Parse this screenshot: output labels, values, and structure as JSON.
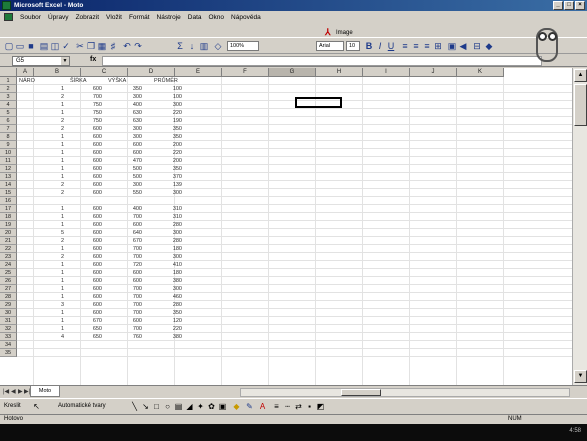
{
  "window": {
    "title": "Microsoft Excel - Moto"
  },
  "menu": [
    "Soubor",
    "Úpravy",
    "Zobrazit",
    "Vložit",
    "Formát",
    "Nástroje",
    "Data",
    "Okno",
    "Nápověda"
  ],
  "mail_button": {
    "label": "Image"
  },
  "toolbar": {
    "zoom": "100%",
    "font": "Arial",
    "font_size": "10"
  },
  "name_box": {
    "value": "G5"
  },
  "formula_bar": {
    "fx": "fx",
    "value": ""
  },
  "columns": [
    "A",
    "B",
    "C",
    "D",
    "E",
    "F",
    "G",
    "H",
    "I",
    "J",
    "K"
  ],
  "selected_column": "G",
  "rows": [
    "1",
    "2",
    "3",
    "4",
    "5",
    "6",
    "7",
    "8",
    "9",
    "10",
    "11",
    "12",
    "13",
    "14",
    "15",
    "16",
    "17",
    "18",
    "19",
    "20",
    "21",
    "22",
    "23",
    "24",
    "25",
    "26",
    "27",
    "28",
    "29",
    "30",
    "31",
    "32",
    "33",
    "34",
    "35"
  ],
  "headers": [
    "NÁRO",
    "ŠÍŘKA",
    "VÝŠKA",
    "PRŮMĚR"
  ],
  "data": [
    [
      "1",
      "600",
      "350",
      "100"
    ],
    [
      "2",
      "700",
      "300",
      "100"
    ],
    [
      "1",
      "750",
      "400",
      "300"
    ],
    [
      "1",
      "750",
      "630",
      "220"
    ],
    [
      "2",
      "750",
      "630",
      "190"
    ],
    [
      "2",
      "600",
      "300",
      "350"
    ],
    [
      "1",
      "600",
      "300",
      "350"
    ],
    [
      "1",
      "600",
      "600",
      "200"
    ],
    [
      "1",
      "600",
      "600",
      "220"
    ],
    [
      "1",
      "600",
      "470",
      "200"
    ],
    [
      "1",
      "600",
      "500",
      "350"
    ],
    [
      "1",
      "600",
      "500",
      "370"
    ],
    [
      "2",
      "600",
      "300",
      "139"
    ],
    [
      "2",
      "600",
      "550",
      "300"
    ],
    [
      "",
      "",
      "",
      ""
    ],
    [
      "1",
      "600",
      "400",
      "310"
    ],
    [
      "1",
      "600",
      "700",
      "310"
    ],
    [
      "1",
      "600",
      "600",
      "280"
    ],
    [
      "5",
      "600",
      "640",
      "300"
    ],
    [
      "2",
      "600",
      "670",
      "280"
    ],
    [
      "1",
      "600",
      "700",
      "180"
    ],
    [
      "2",
      "600",
      "700",
      "300"
    ],
    [
      "1",
      "600",
      "720",
      "410"
    ],
    [
      "1",
      "600",
      "600",
      "180"
    ],
    [
      "1",
      "600",
      "600",
      "380"
    ],
    [
      "1",
      "600",
      "700",
      "300"
    ],
    [
      "1",
      "600",
      "700",
      "460"
    ],
    [
      "3",
      "600",
      "700",
      "280"
    ],
    [
      "1",
      "600",
      "700",
      "350"
    ],
    [
      "1",
      "670",
      "600",
      "120"
    ],
    [
      "1",
      "650",
      "700",
      "220"
    ],
    [
      "4",
      "650",
      "760",
      "380"
    ]
  ],
  "sheet_tab": "Moto",
  "draw_toolbar": {
    "draw": "Kreslit",
    "autoshapes": "Automatické tvary"
  },
  "status": {
    "left": "Hotovo",
    "mode": "NUM"
  },
  "clock": "4:58"
}
